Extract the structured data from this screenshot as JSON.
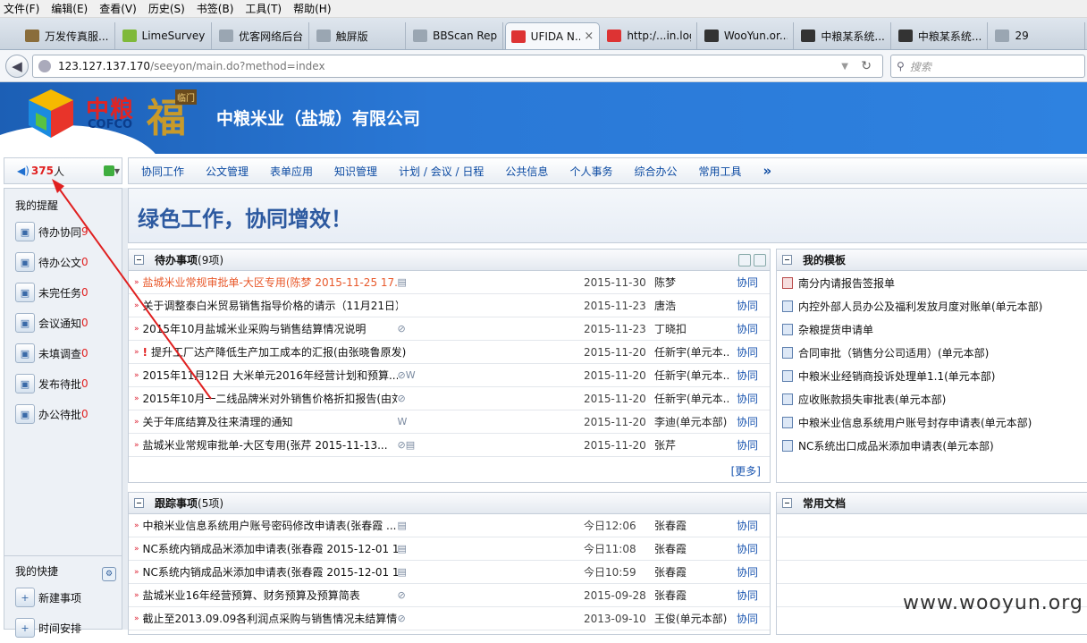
{
  "menu": [
    "文件(F)",
    "编辑(E)",
    "查看(V)",
    "历史(S)",
    "书签(B)",
    "工具(T)",
    "帮助(H)"
  ],
  "tabs": [
    {
      "label": "万发传真服...",
      "color": "#8a6d3b"
    },
    {
      "label": "LimeSurvey",
      "color": "#7fb93a"
    },
    {
      "label": "优客网络后台管...",
      "color": "#9aa6b2"
    },
    {
      "label": "触屏版",
      "color": "#9aa6b2"
    },
    {
      "label": "BBScan Report",
      "color": "#9aa6b2"
    },
    {
      "label": "UFIDA N...",
      "color": "#d33"
    },
    {
      "label": "http:/...in.log",
      "color": "#d33"
    },
    {
      "label": "WooYun.or...",
      "color": "#333"
    },
    {
      "label": "中粮某系统...",
      "color": "#333"
    },
    {
      "label": "中粮某系统...",
      "color": "#333"
    },
    {
      "label": "29",
      "color": "#9aa6b2"
    }
  ],
  "address": {
    "host": "123.127.137.170",
    "path": "/seeyon/main.do?method=index"
  },
  "search_placeholder": "搜索",
  "header": {
    "logo_cn": "中粮",
    "logo_en": "COFCO",
    "logo_fu": "福",
    "logo_fu_tag": "临门",
    "company": "中粮米业（盐城）有限公司"
  },
  "online": {
    "count": "375",
    "unit": "人"
  },
  "mainnav": [
    "协同工作",
    "公文管理",
    "表单应用",
    "知识管理",
    "计划 / 会议 / 日程",
    "公共信息",
    "个人事务",
    "综合办公",
    "常用工具",
    "»"
  ],
  "sidebar": {
    "reminder_title": "我的提醒",
    "items": [
      {
        "label": "待办协同",
        "count": "9",
        "icon": "workflow-icon"
      },
      {
        "label": "待办公文",
        "count": "0",
        "icon": "document-icon"
      },
      {
        "label": "未完任务",
        "count": "0",
        "icon": "task-icon"
      },
      {
        "label": "会议通知",
        "count": "0",
        "icon": "meeting-icon"
      },
      {
        "label": "未填调查",
        "count": "0",
        "icon": "survey-icon"
      },
      {
        "label": "发布待批",
        "count": "0",
        "icon": "chart-icon"
      },
      {
        "label": "办公待批",
        "count": "0",
        "icon": "office-icon"
      }
    ],
    "quick_title": "我的快捷",
    "quick": [
      {
        "label": "新建事项",
        "icon": "new-item-icon"
      },
      {
        "label": "时间安排",
        "icon": "calendar-icon"
      }
    ]
  },
  "banner": "绿色工作，协同增效！",
  "pending": {
    "title": "待办事项",
    "count": "(9项)",
    "more": "[更多]",
    "rows": [
      {
        "title": "盐城米业常规审批单-大区专用(陈梦 2015-11-25 17...",
        "date": "2015-11-30",
        "who": "陈梦",
        "cat": "协同",
        "red": true,
        "att": "▤",
        "bang": false
      },
      {
        "title": "关于调整泰白米贸易销售指导价格的请示（11月21日）(...",
        "date": "2015-11-23",
        "who": "唐浩",
        "cat": "协同",
        "red": false,
        "att": "",
        "bang": false
      },
      {
        "title": "2015年10月盐城米业采购与销售结算情况说明",
        "date": "2015-11-23",
        "who": "丁晓扣",
        "cat": "协同",
        "red": false,
        "att": "⊘",
        "bang": false
      },
      {
        "title": "提升工厂达产降低生产加工成本的汇报(由张晓鲁原发)",
        "date": "2015-11-20",
        "who": "任新宇(单元本...",
        "cat": "协同",
        "red": false,
        "att": "",
        "bang": true
      },
      {
        "title": "2015年11月12日 大米单元2016年经营计划和预算...",
        "date": "2015-11-20",
        "who": "任新宇(单元本...",
        "cat": "协同",
        "red": false,
        "att": "⊘W",
        "bang": false
      },
      {
        "title": "2015年10月一二线品牌米对外销售价格折扣报告(由刘...",
        "date": "2015-11-20",
        "who": "任新宇(单元本...",
        "cat": "协同",
        "red": false,
        "att": "⊘",
        "bang": false
      },
      {
        "title": "关于年底结算及往来清理的通知",
        "date": "2015-11-20",
        "who": "李迪(单元本部)",
        "cat": "协同",
        "red": false,
        "att": "W",
        "bang": false
      },
      {
        "title": "盐城米业常规审批单-大区专用(张芹 2015-11-13...",
        "date": "2015-11-20",
        "who": "张芹",
        "cat": "协同",
        "red": false,
        "att": "⊘▤",
        "bang": false
      }
    ]
  },
  "tracking": {
    "title": "跟踪事项",
    "count": "(5项)",
    "rows": [
      {
        "title": "中粮米业信息系统用户账号密码修改申请表(张春霞 ...",
        "date": "今日12:06",
        "who": "张春霞",
        "cat": "协同",
        "att": "▤"
      },
      {
        "title": "NC系统内销成品米添加申请表(张春霞 2015-12-01 1...",
        "date": "今日11:08",
        "who": "张春霞",
        "cat": "协同",
        "att": "▤"
      },
      {
        "title": "NC系统内销成品米添加申请表(张春霞 2015-12-01 1...",
        "date": "今日10:59",
        "who": "张春霞",
        "cat": "协同",
        "att": "▤"
      },
      {
        "title": "盐城米业16年经营预算、财务预算及预算简表",
        "date": "2015-09-28",
        "who": "张春霞",
        "cat": "协同",
        "att": "⊘"
      },
      {
        "title": "截止至2013.09.09各利润点采购与销售情况未结算情...",
        "date": "2013-09-10",
        "who": "王俊(单元本部)",
        "cat": "协同",
        "att": "⊘"
      }
    ]
  },
  "templates": {
    "title": "我的模板",
    "rows": [
      "南分内请报告签报单",
      "内控外部人员办公及福利发放月度对账单(单元本部)",
      "杂粮提货申请单",
      "合同审批（销售分公司适用）(单元本部)",
      "中粮米业经销商投诉处理单1.1(单元本部)",
      "应收账款损失审批表(单元本部)",
      "中粮米业信息系统用户账号封存申请表(单元本部)",
      "NC系统出口成品米添加申请表(单元本部)"
    ]
  },
  "docs": {
    "title": "常用文档"
  },
  "watermark": "www.wooyun.org",
  "colors": {
    "accent": "#1b56b0",
    "alert": "#e02020",
    "annotation_arrow": "#e02020"
  }
}
